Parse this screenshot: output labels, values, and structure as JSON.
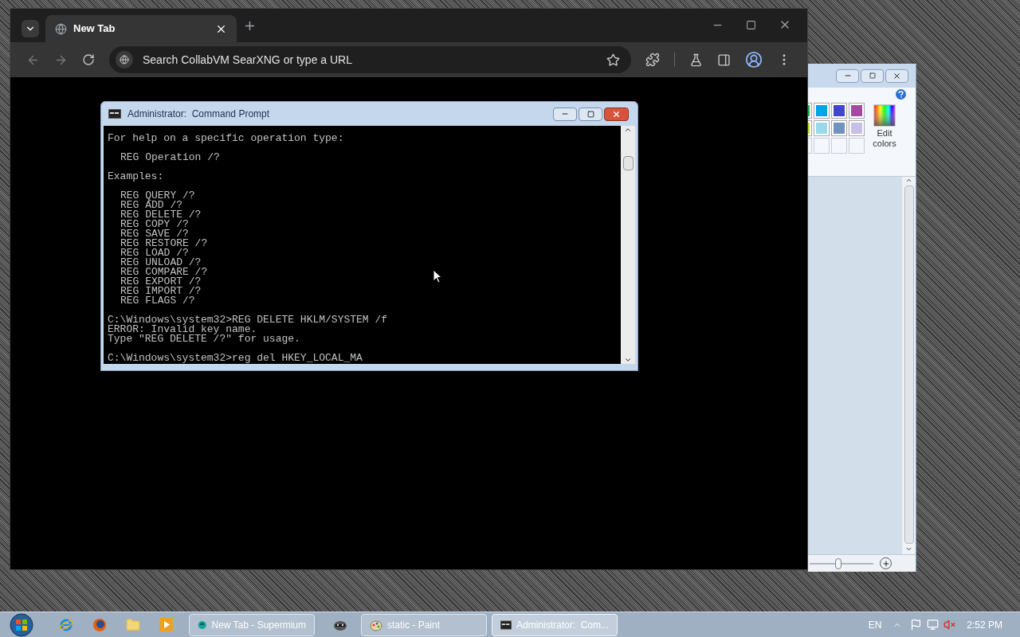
{
  "browser": {
    "tab": {
      "title": "New Tab",
      "selected": true
    },
    "address": {
      "placeholder": "Search CollabVM SearXNG or type a URL"
    }
  },
  "cmd": {
    "title": "Administrator:  Command Prompt",
    "blocks": [
      {
        "indent": false,
        "lines": [
          "For help on a specific operation type:"
        ]
      },
      {
        "indent": true,
        "lines": [
          "REG Operation /?"
        ]
      },
      {
        "indent": false,
        "lines": [
          "Examples:"
        ]
      },
      {
        "indent": true,
        "lines": [
          "REG QUERY /?",
          "REG ADD /?",
          "REG DELETE /?",
          "REG COPY /?",
          "REG SAVE /?",
          "REG RESTORE /?",
          "REG LOAD /?",
          "REG UNLOAD /?",
          "REG COMPARE /?",
          "REG EXPORT /?",
          "REG IMPORT /?",
          "REG FLAGS /?"
        ]
      },
      {
        "indent": false,
        "lines": [
          "C:\\Windows\\system32>REG DELETE HKLM/SYSTEM /f",
          "ERROR: Invalid key name.",
          "Type \"REG DELETE /?\" for usage."
        ]
      },
      {
        "indent": false,
        "lines": [
          "C:\\Windows\\system32>reg del HKEY_LOCAL_MA"
        ]
      }
    ]
  },
  "paint": {
    "swatches": [
      {
        "kind": "color",
        "color": "#22b14c"
      },
      {
        "kind": "color",
        "color": "#00a2e8"
      },
      {
        "kind": "color",
        "color": "#3f48cc"
      },
      {
        "kind": "color",
        "color": "#a349a4"
      },
      {
        "kind": "color",
        "color": "#b5e61d"
      },
      {
        "kind": "color",
        "color": "#99d9ea"
      },
      {
        "kind": "color",
        "color": "#7092be"
      },
      {
        "kind": "color",
        "color": "#c8bfe7"
      },
      {
        "kind": "empty"
      },
      {
        "kind": "empty"
      },
      {
        "kind": "empty"
      },
      {
        "kind": "empty"
      }
    ],
    "edit_colors": "Edit colors",
    "zoom": {
      "level": 0.45
    }
  },
  "taskbar": {
    "tasks": [
      {
        "kind": "browser",
        "label": "New Tab - Supermium",
        "selected": false
      },
      {
        "kind": "paint",
        "label": "static - Paint",
        "selected": false
      },
      {
        "kind": "cmd",
        "label": "Administrator:  Com...",
        "selected": true
      }
    ],
    "language": "EN",
    "clock": "2:52 PM"
  }
}
